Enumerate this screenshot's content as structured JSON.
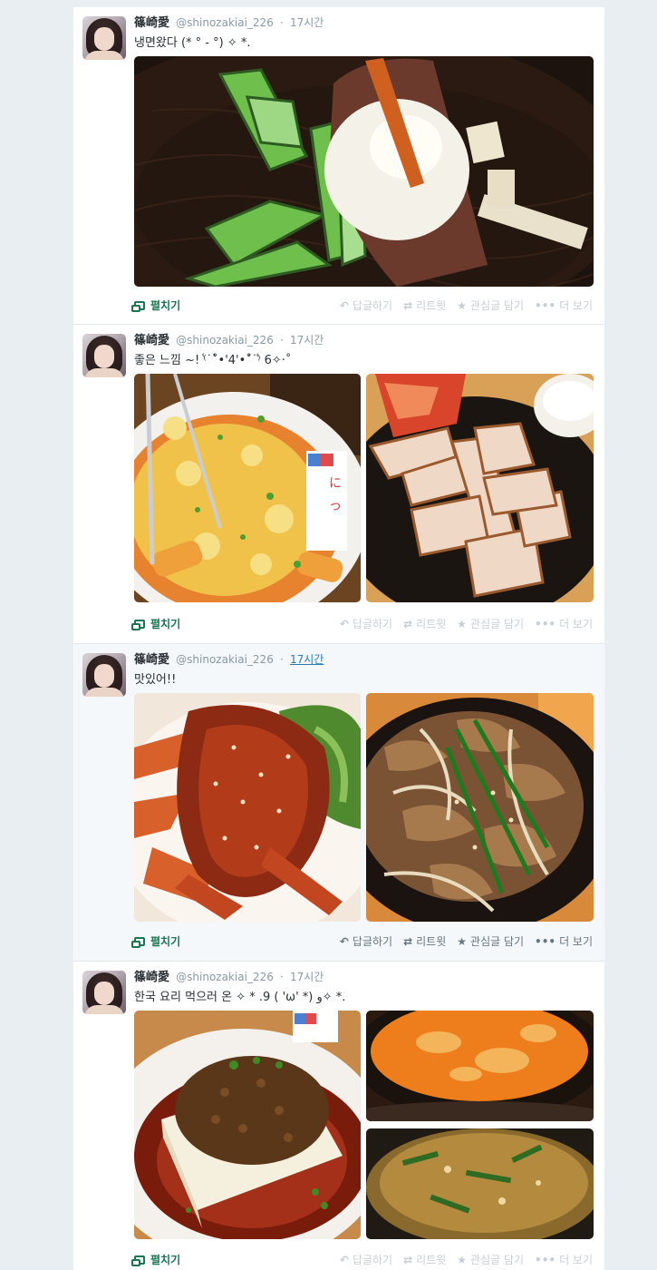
{
  "tweets": [
    {
      "name": "篠崎愛",
      "handle": "@shinozakiai_226",
      "sep": "·",
      "time": "17시간",
      "text": "냉면왔다 (* ° - °) ✧ *.",
      "photos": [
        "naengmyeon"
      ]
    },
    {
      "name": "篠崎愛",
      "handle": "@shinozakiai_226",
      "sep": "·",
      "time": "17시간",
      "text": "좋은 느낌 ~! ⁽͑˙˚̀•'4'•˚́˙⁾͑ 6✧‧˚",
      "photos": [
        "tteokbokki-cheese",
        "samgyeopsal"
      ]
    },
    {
      "name": "篠崎愛",
      "handle": "@shinozakiai_226",
      "sep": "·",
      "time": "17시간",
      "text": "맛있어!!",
      "photos": [
        "yangnyeom-crab",
        "bulgogi"
      ]
    },
    {
      "name": "篠崎愛",
      "handle": "@shinozakiai_226",
      "sep": "·",
      "time": "17시간",
      "text": "한국 요리 먹으러 온 ✧ * .9 ( 'ω' *) ﻭ✧ *.",
      "photos": [
        "tofu-meat",
        "sundubu",
        "pajeon"
      ]
    }
  ],
  "actions": {
    "expand": "펼치기",
    "reply": "답글하기",
    "retweet": "리트윗",
    "favorite": "관심글 담기",
    "more": "더 보기"
  },
  "colors": {
    "expand": "#177751",
    "muted_action": "#c7ced4",
    "active_action": "#66757f",
    "link": "#2b7bb9"
  }
}
